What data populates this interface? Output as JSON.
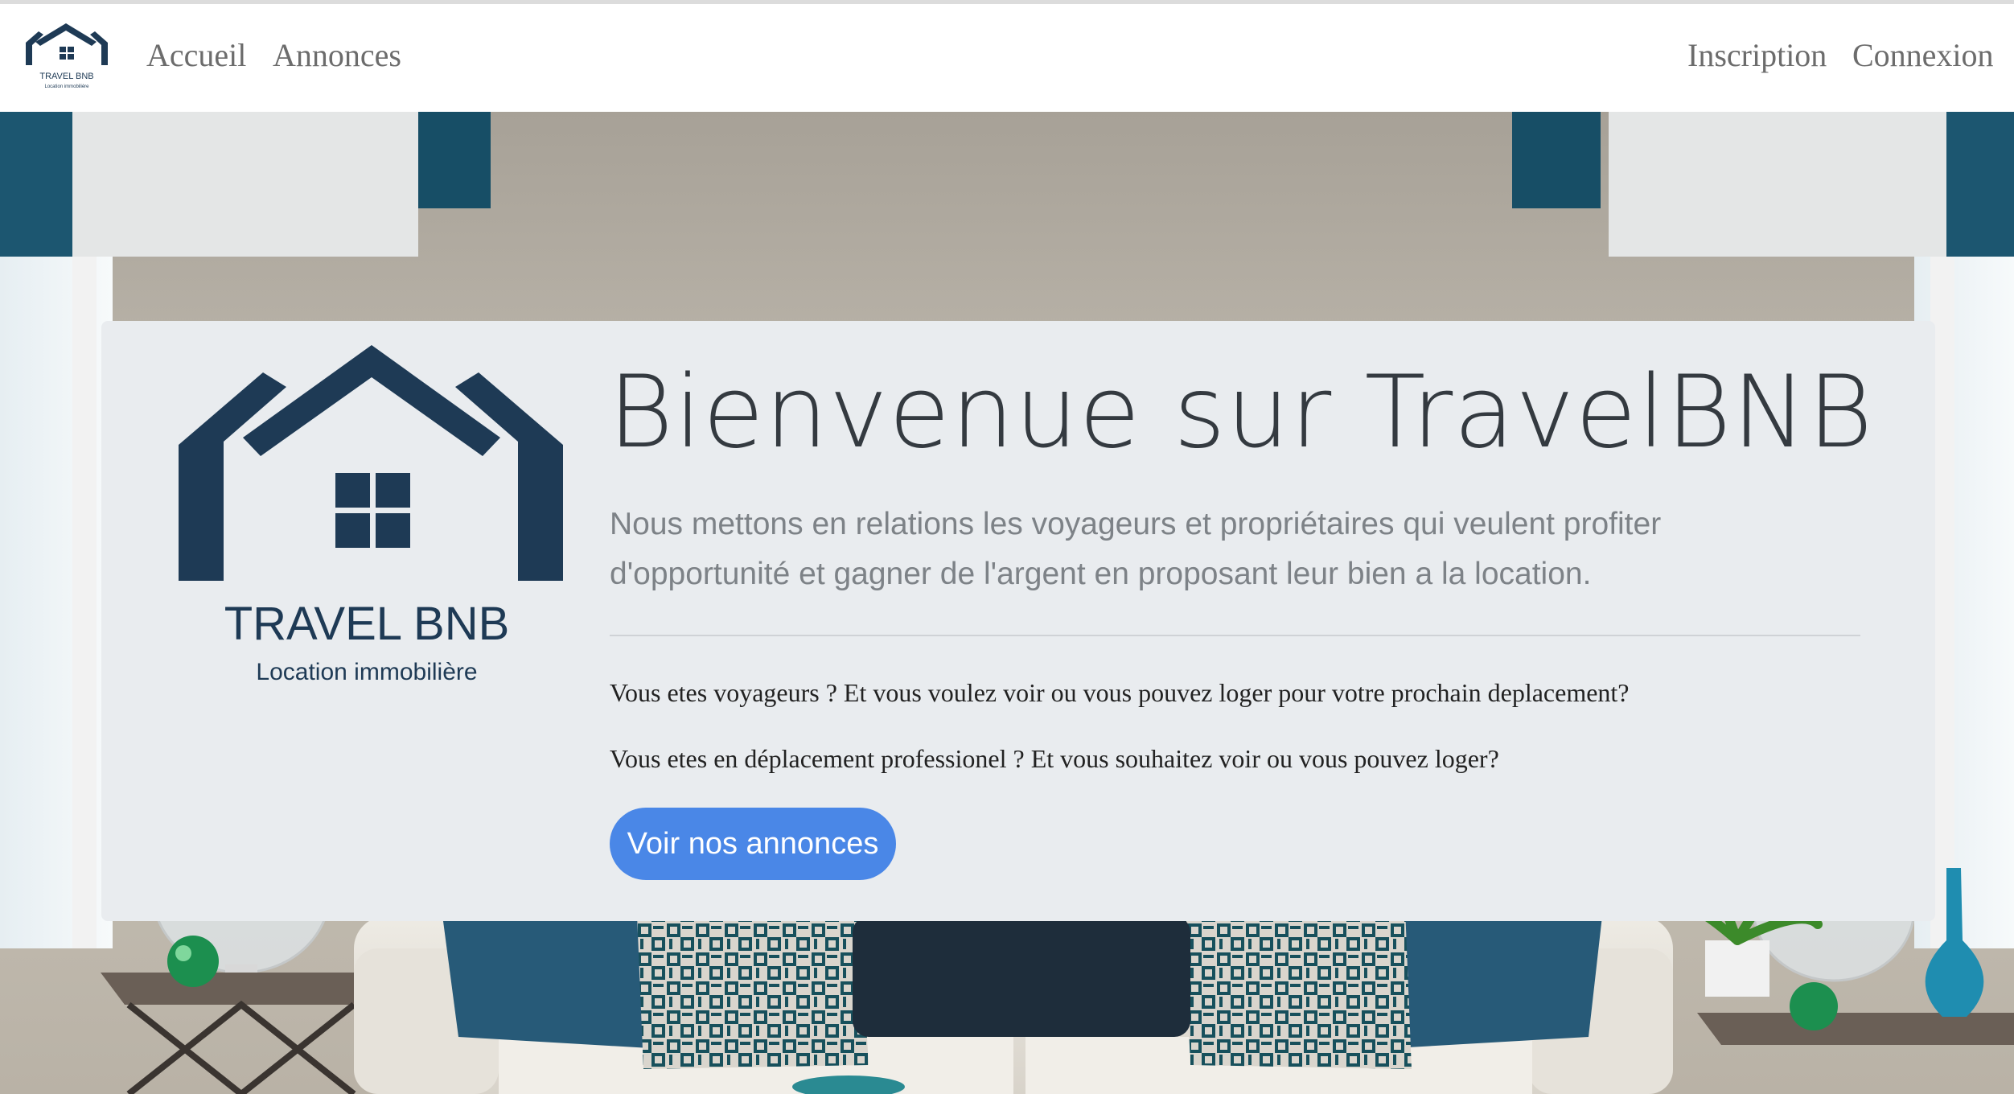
{
  "nav": {
    "links_left": [
      {
        "label": "Accueil"
      },
      {
        "label": "Annonces"
      }
    ],
    "links_right": [
      {
        "label": "Inscription"
      },
      {
        "label": "Connexion"
      }
    ],
    "logo": {
      "brand": "TRAVEL BNB",
      "tagline": "Location immobilière"
    }
  },
  "hero": {
    "title": "Bienvenue sur TravelBNB",
    "lead": "Nous mettons en relations les voyageurs et propriétaires qui veulent profiter d'opportunité et gagner de l'argent en proposant leur bien a la location.",
    "paragraphs": [
      "Vous etes voyageurs ? Et vous voulez voir ou vous pouvez loger pour votre prochain deplacement?",
      "Vous etes en déplacement professionel ? Et vous souhaitez voir ou vous pouvez loger?"
    ],
    "cta_label": "Voir nos annonces",
    "logo": {
      "brand": "TRAVEL BNB",
      "tagline": "Location immobilière"
    }
  },
  "colors": {
    "brand_navy": "#1e3a55",
    "cta_blue": "#4a87e7",
    "card_bg": "#e9ecef",
    "nav_text": "#6c6c6c"
  }
}
